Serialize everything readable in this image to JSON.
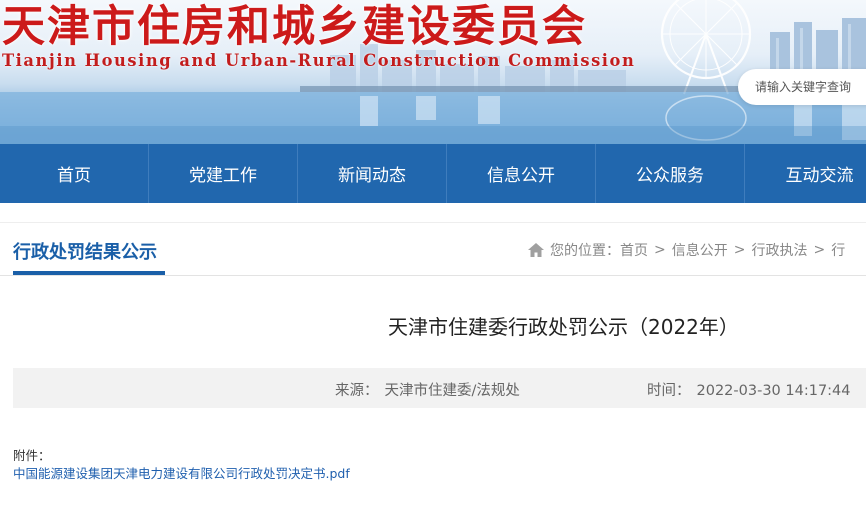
{
  "banner": {
    "title": "天津市住房和城乡建设委员会",
    "subtitle": "Tianjin Housing and Urban-Rural Construction Commission"
  },
  "search": {
    "placeholder": "请输入关键字查询"
  },
  "nav": {
    "items": [
      {
        "label": "首页"
      },
      {
        "label": "党建工作"
      },
      {
        "label": "新闻动态"
      },
      {
        "label": "信息公开"
      },
      {
        "label": "公众服务"
      },
      {
        "label": "互动交流"
      }
    ]
  },
  "section": {
    "title": "行政处罚结果公示"
  },
  "breadcrumb": {
    "prefix": "您的位置：",
    "items": [
      "首页",
      "信息公开",
      "行政执法",
      "行"
    ],
    "separator": ">"
  },
  "article": {
    "title": "天津市住建委行政处罚公示（2022年）",
    "source_label": "来源：",
    "source_value": "天津市住建委/法规处",
    "time_label": "时间：",
    "time_value": "2022-03-30 14:17:44",
    "attachment_label": "附件：",
    "attachment_link": "中国能源建设集团天津电力建设有限公司行政处罚决定书.pdf"
  },
  "colors": {
    "nav_bg": "#2167ae",
    "banner_title": "#cc1a1a",
    "section_title": "#1a5fa8",
    "link": "#1f5fae"
  },
  "icons": {
    "breadcrumb_home": "home-icon"
  }
}
